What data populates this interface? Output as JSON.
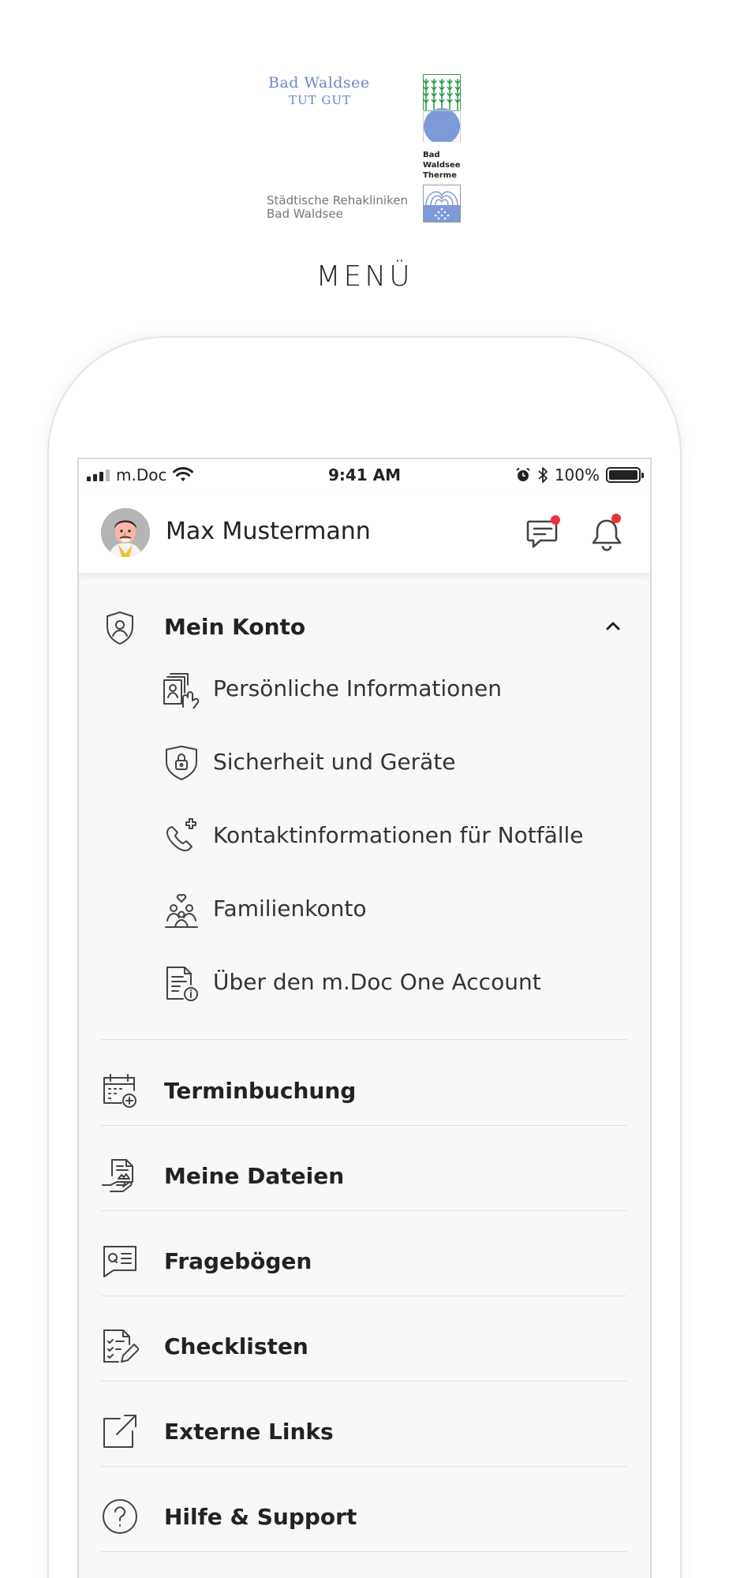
{
  "branding": {
    "bad_waldsee": "Bad Waldsee",
    "tagline": "TUT GUT",
    "therme_line1": "Bad",
    "therme_line2": "Waldsee",
    "therme_line3": "Therme",
    "reha_line1": "Städtische Rehakliniken",
    "reha_line2": "Bad Waldsee"
  },
  "page_title": "MENÜ",
  "status_bar": {
    "carrier": "m.Doc",
    "time": "9:41 AM",
    "battery": "100%"
  },
  "user": {
    "name": "Max Mustermann"
  },
  "menu": {
    "account": {
      "label": "Mein Konto",
      "expanded": true,
      "items": [
        {
          "label": "Persönliche Informationen",
          "icon": "personal-info-icon"
        },
        {
          "label": "Sicherheit und Geräte",
          "icon": "shield-lock-icon"
        },
        {
          "label": "Kontaktinformationen für Notfälle",
          "icon": "emergency-phone-icon"
        },
        {
          "label": "Familienkonto",
          "icon": "family-icon"
        },
        {
          "label": "Über den m.Doc One Account",
          "icon": "document-info-icon"
        }
      ]
    },
    "items": [
      {
        "label": "Terminbuchung",
        "icon": "calendar-plus-icon"
      },
      {
        "label": "Meine Dateien",
        "icon": "files-icon"
      },
      {
        "label": "Fragebögen",
        "icon": "questionnaire-icon"
      },
      {
        "label": "Checklisten",
        "icon": "checklist-icon"
      },
      {
        "label": "Externe Links",
        "icon": "external-link-icon"
      },
      {
        "label": "Hilfe & Support",
        "icon": "help-icon"
      }
    ]
  },
  "colors": {
    "notification_dot": "#e8333a",
    "logo_blue": "#6b86c6",
    "logo_green": "#2d9a4a"
  }
}
